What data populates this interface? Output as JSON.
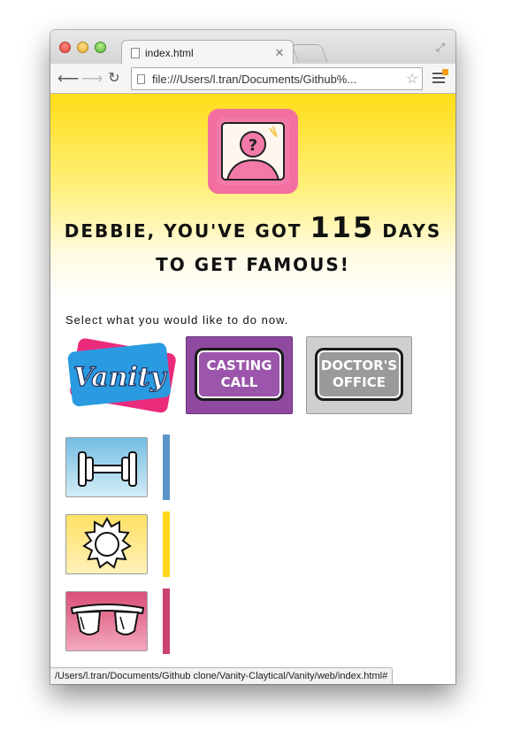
{
  "browser": {
    "tab_title": "index.html",
    "url": "file:///Users/l.tran/Documents/Github%...",
    "status_url": "/Users/l.tran/Documents/Github clone/Vanity-Claytical/Vanity/web/index.html#"
  },
  "hero": {
    "headline_before": "Debbie, you've got ",
    "days": "115",
    "headline_after": " days to get famous!"
  },
  "instruction": "Select what you would like to do now.",
  "cards": {
    "vanity": "Vanity",
    "casting_line1": "Casting",
    "casting_line2": "Call",
    "doctor_line1": "Doctor's",
    "doctor_line2": "Office"
  },
  "stats": [
    {
      "name": "fitness",
      "icon": "dumbbell-icon",
      "color": "#5b95c8",
      "level": 1.0
    },
    {
      "name": "sun",
      "icon": "sun-icon",
      "color": "#ffd91a",
      "level": 1.0
    },
    {
      "name": "glam",
      "icon": "sunglasses-icon",
      "color": "#c9436d",
      "level": 1.0
    }
  ]
}
